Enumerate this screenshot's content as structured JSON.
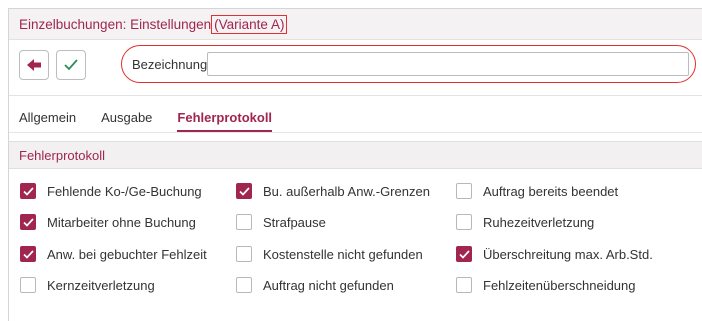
{
  "window": {
    "title": "Einzelbuchungen: Einstellungen",
    "variant": "(Variante A)"
  },
  "toolbar": {
    "back_icon": "arrow-left-icon",
    "confirm_icon": "checkmark-icon",
    "bezeichnung_label": "Bezeichnung",
    "bezeichnung_value": ""
  },
  "tabs": [
    {
      "label": "Allgemein",
      "active": false
    },
    {
      "label": "Ausgabe",
      "active": false
    },
    {
      "label": "Fehlerprotokoll",
      "active": true
    }
  ],
  "section": {
    "title": "Fehlerprotokoll"
  },
  "options": [
    {
      "label": "Fehlende Ko-/Ge-Buchung",
      "checked": true
    },
    {
      "label": "Bu. außerhalb Anw.-Grenzen",
      "checked": true
    },
    {
      "label": "Auftrag bereits beendet",
      "checked": false
    },
    {
      "label": "Mitarbeiter ohne Buchung",
      "checked": true
    },
    {
      "label": "Strafpause",
      "checked": false
    },
    {
      "label": "Ruhezeitverletzung",
      "checked": false
    },
    {
      "label": "Anw. bei gebuchter Fehlzeit",
      "checked": true
    },
    {
      "label": "Kostenstelle nicht gefunden",
      "checked": false
    },
    {
      "label": "Überschreitung max. Arb.Std.",
      "checked": true
    },
    {
      "label": "Kernzeitverletzung",
      "checked": false
    },
    {
      "label": "Auftrag nicht gefunden",
      "checked": false
    },
    {
      "label": "Fehlzeitenüberschneidung",
      "checked": false
    }
  ],
  "colors": {
    "accent": "#a0264f",
    "highlight": "#e03030"
  }
}
